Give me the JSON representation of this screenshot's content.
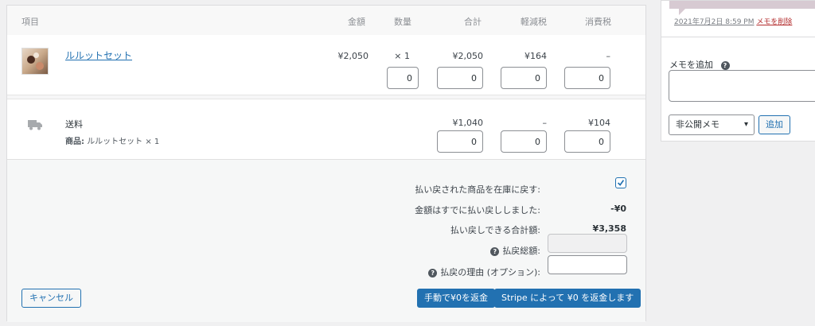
{
  "table": {
    "headers": {
      "item": "項目",
      "price": "金額",
      "qty": "数量",
      "total": "合計",
      "reduced_tax": "軽減税",
      "consumption_tax": "消費税"
    },
    "line_item": {
      "name": "ルルットセット",
      "price": "¥2,050",
      "qty": "× 1",
      "total": "¥2,050",
      "reduced_tax": "¥164",
      "consumption_tax": "–",
      "refund_qty": "0",
      "refund_total": "0",
      "refund_reduced_tax": "0",
      "refund_consumption_tax": "0"
    },
    "shipping": {
      "name": "送料",
      "meta_label": "商品:",
      "meta_value": "ルルットセット × 1",
      "total": "¥1,040",
      "reduced_tax": "–",
      "consumption_tax": "¥104",
      "refund_total": "0",
      "refund_reduced_tax": "0",
      "refund_consumption_tax": "0"
    }
  },
  "refund": {
    "restock_label": "払い戻された商品を在庫に戻す:",
    "restock_checked": true,
    "already_refunded_label": "金額はすでに払い戻ししました:",
    "already_refunded_value": "-¥0",
    "available_label": "払い戻しできる合計額:",
    "available_value": "¥3,358",
    "amount_label": "払戻総額:",
    "amount_value": "",
    "reason_label": "払戻の理由 (オプション):",
    "reason_value": "",
    "cancel_button": "キャンセル",
    "manual_button": "手動で¥0を返金",
    "stripe_button": "Stripe によって ¥0 を返金します"
  },
  "notes": {
    "last_note_date": "2021年7月2日 8:59 PM",
    "delete_link": "メモを削除",
    "add_label": "メモを追加",
    "add_value": "",
    "type_selected": "非公開メモ",
    "add_button": "追加"
  },
  "colors": {
    "accent": "#2271b1",
    "note_bubble": "#d7cad2",
    "delete": "#b32d2e"
  }
}
